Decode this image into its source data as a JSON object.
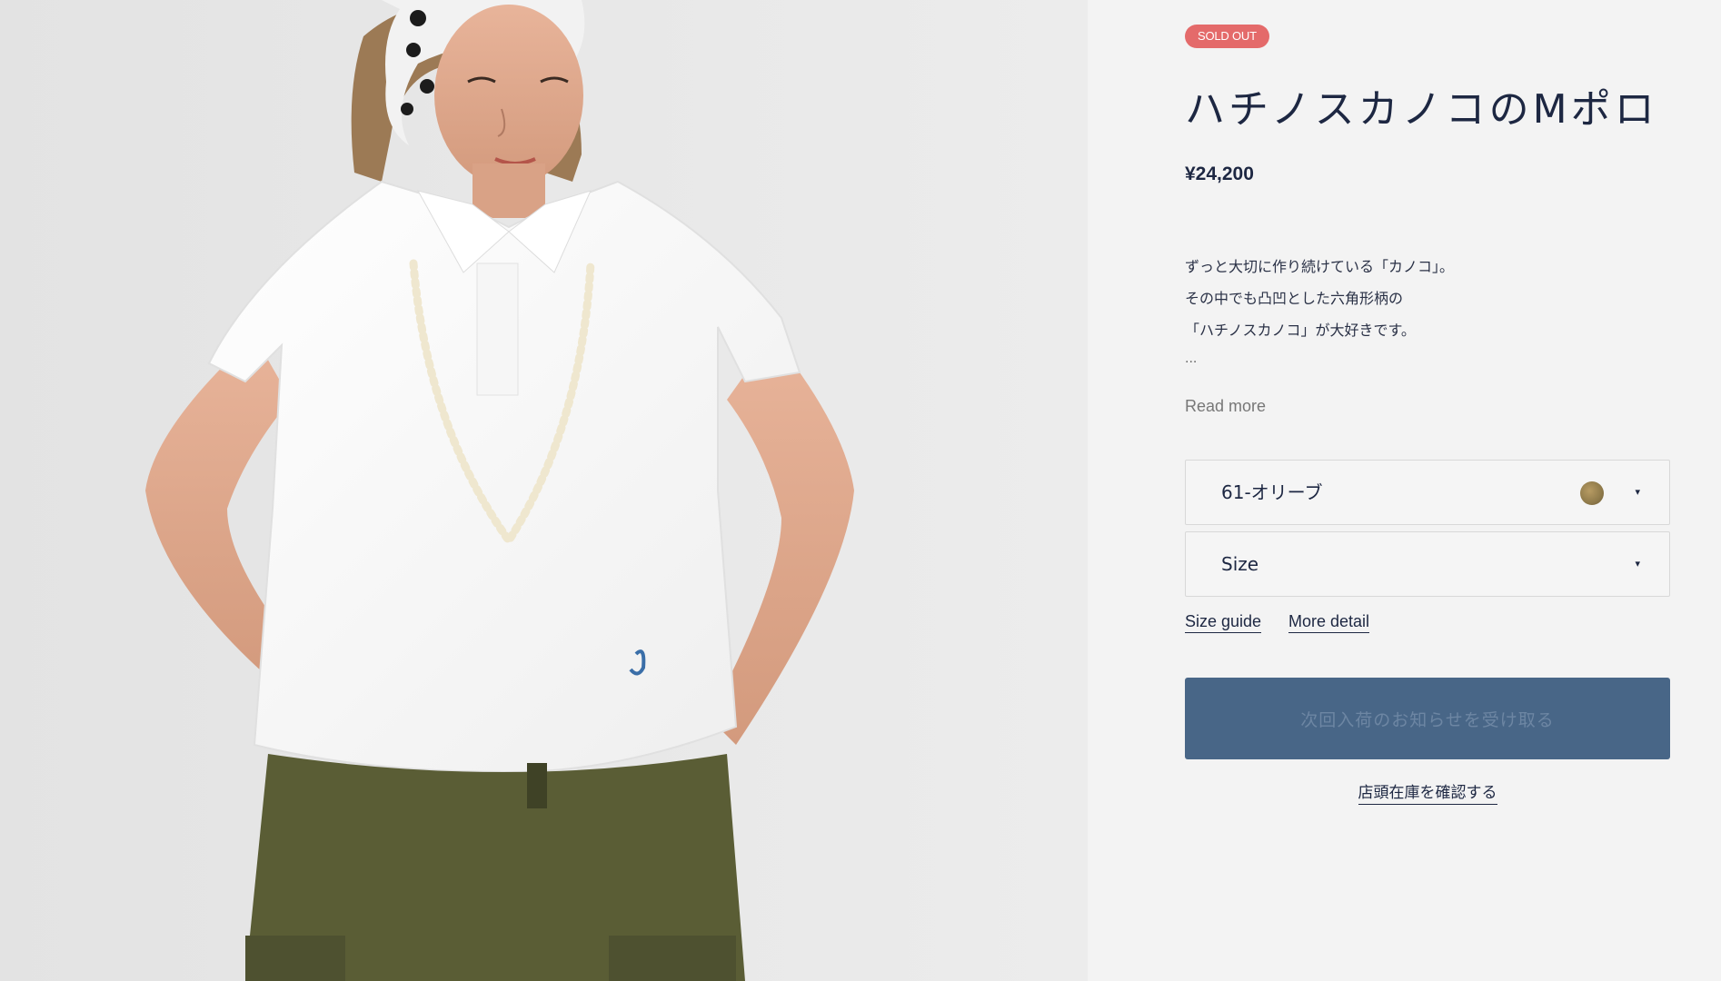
{
  "product": {
    "badge": "SOLD OUT",
    "title": "ハチノスカノコのMポロ",
    "price": "¥24,200",
    "description": [
      "ずっと大切に作り続けている「カノコ」。",
      "その中でも凸凹とした六角形柄の",
      "「ハチノスカノコ」が大好きです。"
    ],
    "ellipsis": "...",
    "read_more": "Read more"
  },
  "options": {
    "color_value": "61-オリーブ",
    "color_swatch": "#8f7a4a",
    "size_value": "Size",
    "caret": "▾"
  },
  "links": {
    "size_guide": "Size guide",
    "more_detail": "More detail"
  },
  "actions": {
    "notify_label": "次回入荷のお知らせを受け取る",
    "store_stock_label": "店頭在庫を確認する"
  },
  "colors": {
    "badge_bg": "#e46a6a",
    "button_bg": "#486687",
    "text": "#1d2742"
  }
}
